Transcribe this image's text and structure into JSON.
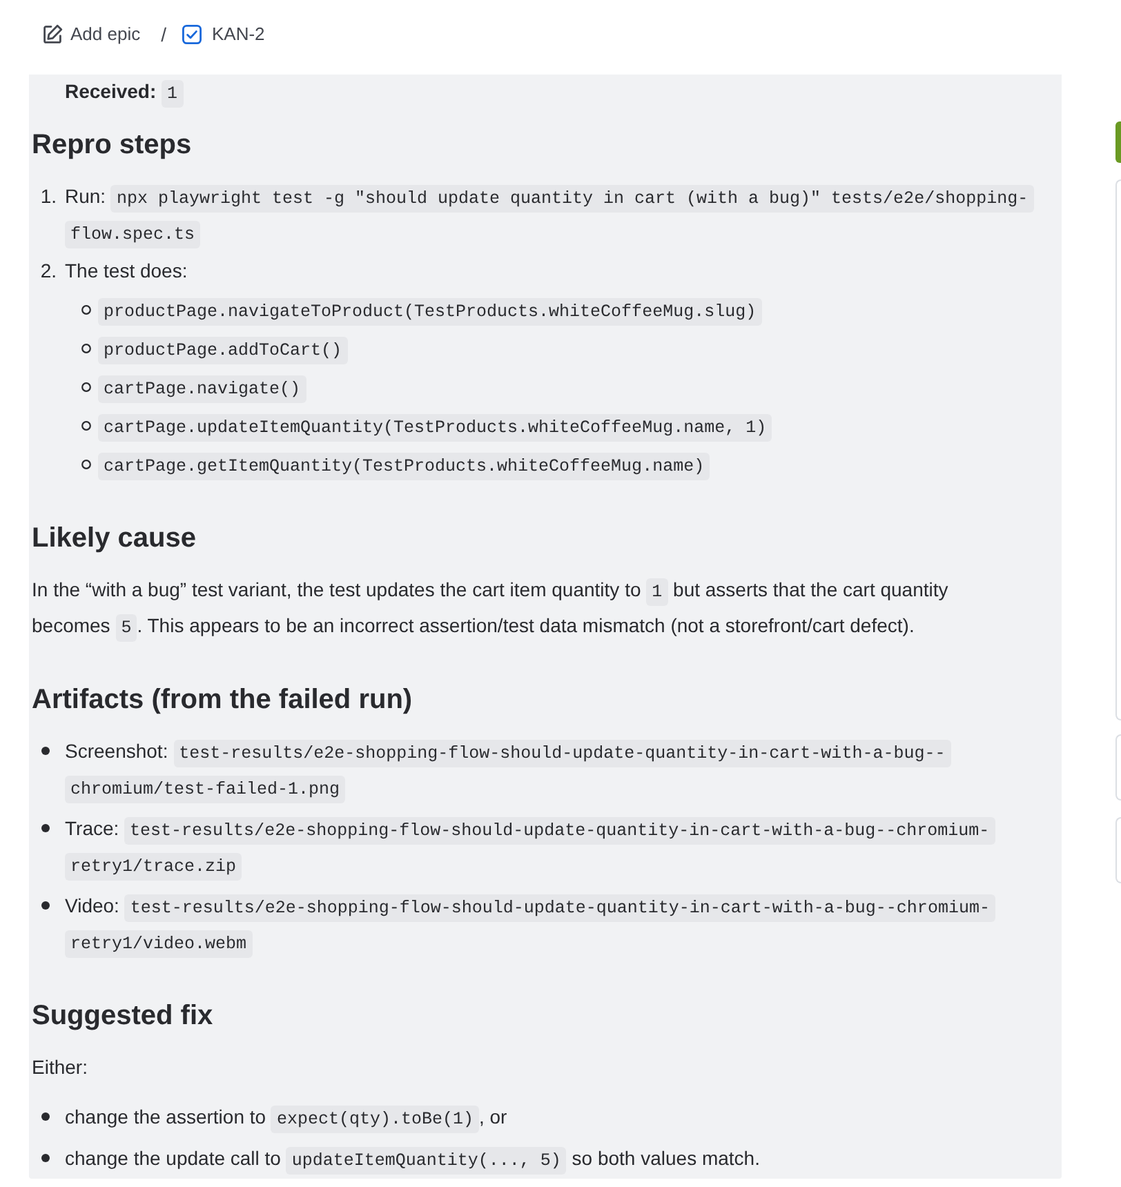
{
  "breadcrumb": {
    "items": [
      {
        "kind": "epic",
        "label": "Add epic"
      },
      {
        "kind": "issue",
        "label": "KAN-2"
      }
    ],
    "separator": "/"
  },
  "description": {
    "blocks": [
      {
        "kind": "line",
        "parts": [
          {
            "kind": "bold",
            "text": "Received: "
          },
          {
            "kind": "code",
            "text": "1"
          }
        ]
      },
      {
        "kind": "heading",
        "text": "Repro steps"
      },
      {
        "kind": "numbered_list",
        "items": [
          {
            "marker": "1.",
            "parts": [
              {
                "kind": "text",
                "text": "Run: "
              },
              {
                "kind": "code",
                "text": "npx playwright test -g \"should update quantity in cart (with a bug)\" tests/e2e/shopping-flow.spec.ts"
              }
            ]
          },
          {
            "marker": "2.",
            "parts": [
              {
                "kind": "text",
                "text": "The test does:"
              }
            ],
            "children": [
              {
                "parts": [
                  {
                    "kind": "code",
                    "text": "productPage.navigateToProduct(TestProducts.whiteCoffeeMug.slug)"
                  }
                ]
              },
              {
                "parts": [
                  {
                    "kind": "code",
                    "text": "productPage.addToCart()"
                  }
                ]
              },
              {
                "parts": [
                  {
                    "kind": "code",
                    "text": "cartPage.navigate()"
                  }
                ]
              },
              {
                "parts": [
                  {
                    "kind": "code",
                    "text": "cartPage.updateItemQuantity(TestProducts.whiteCoffeeMug.name, 1)"
                  }
                ]
              },
              {
                "parts": [
                  {
                    "kind": "code",
                    "text": "cartPage.getItemQuantity(TestProducts.whiteCoffeeMug.name)"
                  }
                ]
              }
            ]
          }
        ]
      },
      {
        "kind": "heading",
        "text": "Likely cause"
      },
      {
        "kind": "paragraph",
        "parts": [
          {
            "kind": "text",
            "text": "In the “with a bug” test variant, the test updates the cart item quantity to "
          },
          {
            "kind": "code",
            "text": "1"
          },
          {
            "kind": "text",
            "text": " but asserts that the cart quantity becomes "
          },
          {
            "kind": "code",
            "text": "5"
          },
          {
            "kind": "text",
            "text": ". This appears to be an incorrect assertion/test data mismatch (not a storefront/cart defect)."
          }
        ]
      },
      {
        "kind": "heading",
        "text": "Artifacts (from the failed run)"
      },
      {
        "kind": "bullet_list",
        "items": [
          {
            "parts": [
              {
                "kind": "text",
                "text": "Screenshot: "
              },
              {
                "kind": "code",
                "text": "test-results/e2e-shopping-flow-should-update-quantity-in-cart-with-a-bug--chromium/test-failed-1.png"
              }
            ]
          },
          {
            "parts": [
              {
                "kind": "text",
                "text": "Trace: "
              },
              {
                "kind": "code",
                "text": "test-results/e2e-shopping-flow-should-update-quantity-in-cart-with-a-bug--chromium-retry1/trace.zip"
              }
            ]
          },
          {
            "parts": [
              {
                "kind": "text",
                "text": "Video: "
              },
              {
                "kind": "code",
                "text": "test-results/e2e-shopping-flow-should-update-quantity-in-cart-with-a-bug--chromium-retry1/video.webm"
              }
            ]
          }
        ]
      },
      {
        "kind": "heading",
        "text": "Suggested fix"
      },
      {
        "kind": "paragraph",
        "parts": [
          {
            "kind": "text",
            "text": "Either:"
          }
        ]
      },
      {
        "kind": "bullet_list",
        "items": [
          {
            "parts": [
              {
                "kind": "text",
                "text": "change the assertion to "
              },
              {
                "kind": "code",
                "text": "expect(qty).toBe(1)"
              },
              {
                "kind": "text",
                "text": ", or"
              }
            ]
          },
          {
            "parts": [
              {
                "kind": "text",
                "text": "change the update call to "
              },
              {
                "kind": "code",
                "text": "updateItemQuantity(..., 5)"
              },
              {
                "kind": "text",
                "text": " so both values match."
              }
            ]
          }
        ]
      }
    ]
  }
}
